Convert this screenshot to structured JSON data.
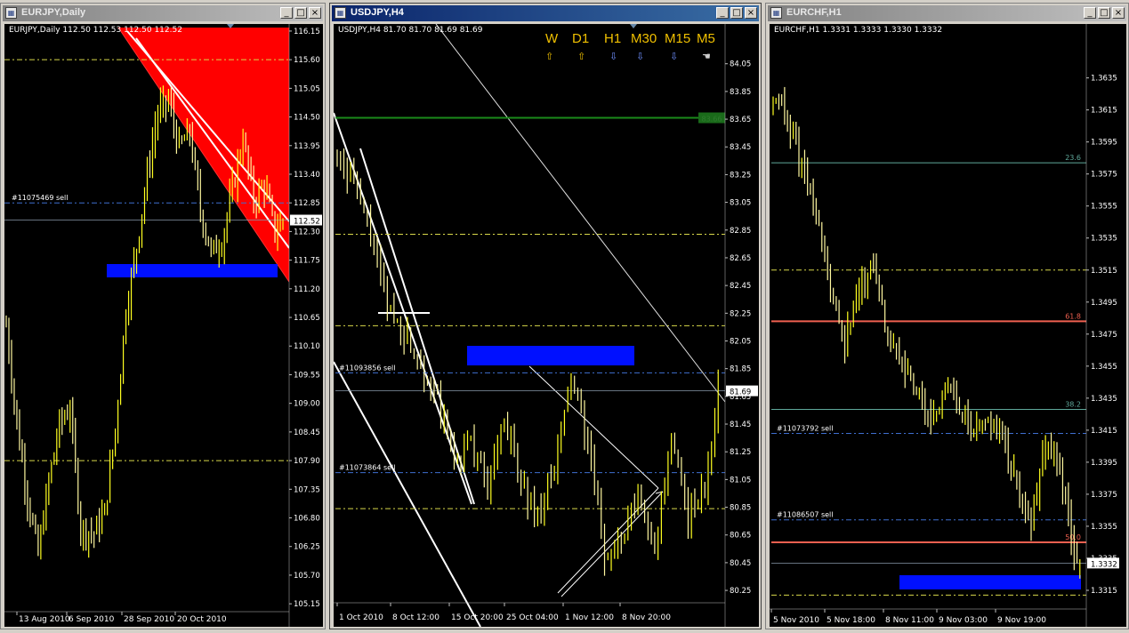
{
  "windows": [
    {
      "title": "EURJPY,Daily",
      "info": "EURJPY,Daily  112.50 112.53 112.50 112.52",
      "win_buttons": [
        "_",
        "□",
        "×"
      ],
      "price_max": 116.2,
      "price_min": 105.05,
      "price_labels": [
        "116.15",
        "115.60",
        "115.05",
        "114.50",
        "113.95",
        "113.40",
        "112.85",
        "112.30",
        "111.75",
        "111.20",
        "110.65",
        "110.10",
        "109.55",
        "109.00",
        "108.45",
        "107.90",
        "107.35",
        "106.80",
        "106.25",
        "105.70",
        "105.15"
      ],
      "current_price": "112.52",
      "current_value": 112.52,
      "time_labels": [
        "13 Aug 2010",
        "6 Sep 2010",
        "28 Sep 2010",
        "20 Oct 2010"
      ],
      "order_labels": [
        {
          "text": "#11075469 sell",
          "value": 112.85
        }
      ],
      "level_values": [
        115.6,
        107.9
      ],
      "candles": {
        "count": 105,
        "seed": 7,
        "path": [
          [
            0,
            110.5
          ],
          [
            4,
            108.6
          ],
          [
            8,
            107.2
          ],
          [
            12,
            106.1
          ],
          [
            16,
            107.5
          ],
          [
            20,
            108.6
          ],
          [
            24,
            108.9
          ],
          [
            28,
            106.6
          ],
          [
            33,
            106.5
          ],
          [
            37,
            106.9
          ],
          [
            41,
            108.5
          ],
          [
            45,
            110.8
          ],
          [
            49,
            112.0
          ],
          [
            53,
            113.4
          ],
          [
            57,
            114.6
          ],
          [
            61,
            114.8
          ],
          [
            65,
            113.9
          ],
          [
            69,
            114.2
          ],
          [
            73,
            112.7
          ],
          [
            77,
            111.9
          ],
          [
            81,
            112.1
          ],
          [
            85,
            113.1
          ],
          [
            89,
            114.1
          ],
          [
            93,
            112.9
          ],
          [
            97,
            113.2
          ],
          [
            101,
            112.3
          ],
          [
            104,
            112.52
          ]
        ]
      }
    },
    {
      "title": "USDJPY,H4",
      "info": "USDJPY,H4  81.70 81.70 81.69 81.69",
      "win_buttons": [
        "_",
        "□",
        "×"
      ],
      "price_max": 84.17,
      "price_min": 80.18,
      "price_labels": [
        "84.05",
        "83.85",
        "83.65",
        "83.45",
        "83.25",
        "83.05",
        "82.85",
        "82.65",
        "82.45",
        "82.25",
        "82.05",
        "81.85",
        "81.65",
        "81.45",
        "81.25",
        "81.05",
        "80.85",
        "80.65",
        "80.45",
        "80.25"
      ],
      "current_price": "81.69",
      "current_value": 81.69,
      "green_level": {
        "text": "83.66",
        "value": 83.66
      },
      "time_labels": [
        "1 Oct 2010",
        "8 Oct 12:00",
        "15 Oct 20:00",
        "25 Oct 04:00",
        "1 Nov 12:00",
        "8 Nov 20:00"
      ],
      "order_labels": [
        {
          "text": "#11093856 sell",
          "value": 81.82
        },
        {
          "text": "#11073864 sell",
          "value": 81.1
        }
      ],
      "level_values": [
        82.82,
        82.16,
        80.84
      ],
      "timeframes": [
        {
          "label": "W",
          "arrow": "⇧",
          "color": "#f0c000"
        },
        {
          "label": "D1",
          "arrow": "⇧",
          "color": "#f0c000"
        },
        {
          "label": "H1",
          "arrow": "⇩",
          "color": "#6f8fff"
        },
        {
          "label": "M30",
          "arrow": "⇩",
          "color": "#6f8fff"
        },
        {
          "label": "M15",
          "arrow": "⇩",
          "color": "#6f8fff"
        },
        {
          "label": "M5",
          "arrow": "☚",
          "color": "#d0d0d0"
        }
      ],
      "candles": {
        "count": 115,
        "seed": 21,
        "path": [
          [
            0,
            83.4
          ],
          [
            5,
            83.2
          ],
          [
            10,
            82.8
          ],
          [
            15,
            82.3
          ],
          [
            20,
            82.1
          ],
          [
            25,
            81.9
          ],
          [
            30,
            81.6
          ],
          [
            35,
            81.2
          ],
          [
            40,
            81.3
          ],
          [
            45,
            81.0
          ],
          [
            50,
            81.5
          ],
          [
            55,
            81.0
          ],
          [
            60,
            80.8
          ],
          [
            65,
            81.1
          ],
          [
            70,
            81.8
          ],
          [
            75,
            81.3
          ],
          [
            80,
            80.5
          ],
          [
            85,
            80.6
          ],
          [
            90,
            80.9
          ],
          [
            95,
            80.6
          ],
          [
            100,
            81.3
          ],
          [
            105,
            80.8
          ],
          [
            110,
            81.0
          ],
          [
            114,
            81.69
          ]
        ]
      }
    },
    {
      "title": "EURCHF,H1",
      "info": "EURCHF,H1  1.3331 1.3333 1.3330 1.3332",
      "win_buttons": [
        "_",
        "□",
        "×"
      ],
      "price_max": 1.3652,
      "price_min": 1.3305,
      "price_labels": [
        "1.3635",
        "1.3615",
        "1.3595",
        "1.3575",
        "1.3555",
        "1.3535",
        "1.3515",
        "1.3495",
        "1.3475",
        "1.3455",
        "1.3435",
        "1.3415",
        "1.3395",
        "1.3375",
        "1.3355",
        "1.3335",
        "1.3315"
      ],
      "current_price": "1.3332",
      "current_value": 1.3332,
      "time_labels": [
        "5 Nov 2010",
        "5 Nov 18:00",
        "8 Nov 11:00",
        "9 Nov 03:00",
        "9 Nov 19:00"
      ],
      "order_labels": [
        {
          "text": "#11073792 sell",
          "value": 1.3413
        },
        {
          "text": "#11086507 sell",
          "value": 1.3359
        }
      ],
      "level_values": [
        1.3515,
        1.3312
      ],
      "fib": [
        {
          "text": "23.6",
          "value": 1.3582,
          "color": "#5fa89a"
        },
        {
          "text": "61.8",
          "value": 1.3483,
          "color": "#f06050"
        },
        {
          "text": "38.2",
          "value": 1.3428,
          "color": "#5fa89a"
        },
        {
          "text": "50.0",
          "value": 1.3345,
          "color": "#f06050"
        }
      ],
      "candles": {
        "count": 108,
        "seed": 33,
        "path": [
          [
            0,
            1.362
          ],
          [
            5,
            1.361
          ],
          [
            10,
            1.358
          ],
          [
            15,
            1.355
          ],
          [
            20,
            1.35
          ],
          [
            25,
            1.347
          ],
          [
            30,
            1.35
          ],
          [
            35,
            1.352
          ],
          [
            40,
            1.347
          ],
          [
            45,
            1.346
          ],
          [
            50,
            1.344
          ],
          [
            55,
            1.342
          ],
          [
            60,
            1.344
          ],
          [
            65,
            1.343
          ],
          [
            70,
            1.341
          ],
          [
            75,
            1.342
          ],
          [
            80,
            1.341
          ],
          [
            85,
            1.338
          ],
          [
            90,
            1.336
          ],
          [
            95,
            1.341
          ],
          [
            100,
            1.339
          ],
          [
            105,
            1.334
          ],
          [
            107,
            1.3332
          ]
        ]
      }
    }
  ]
}
